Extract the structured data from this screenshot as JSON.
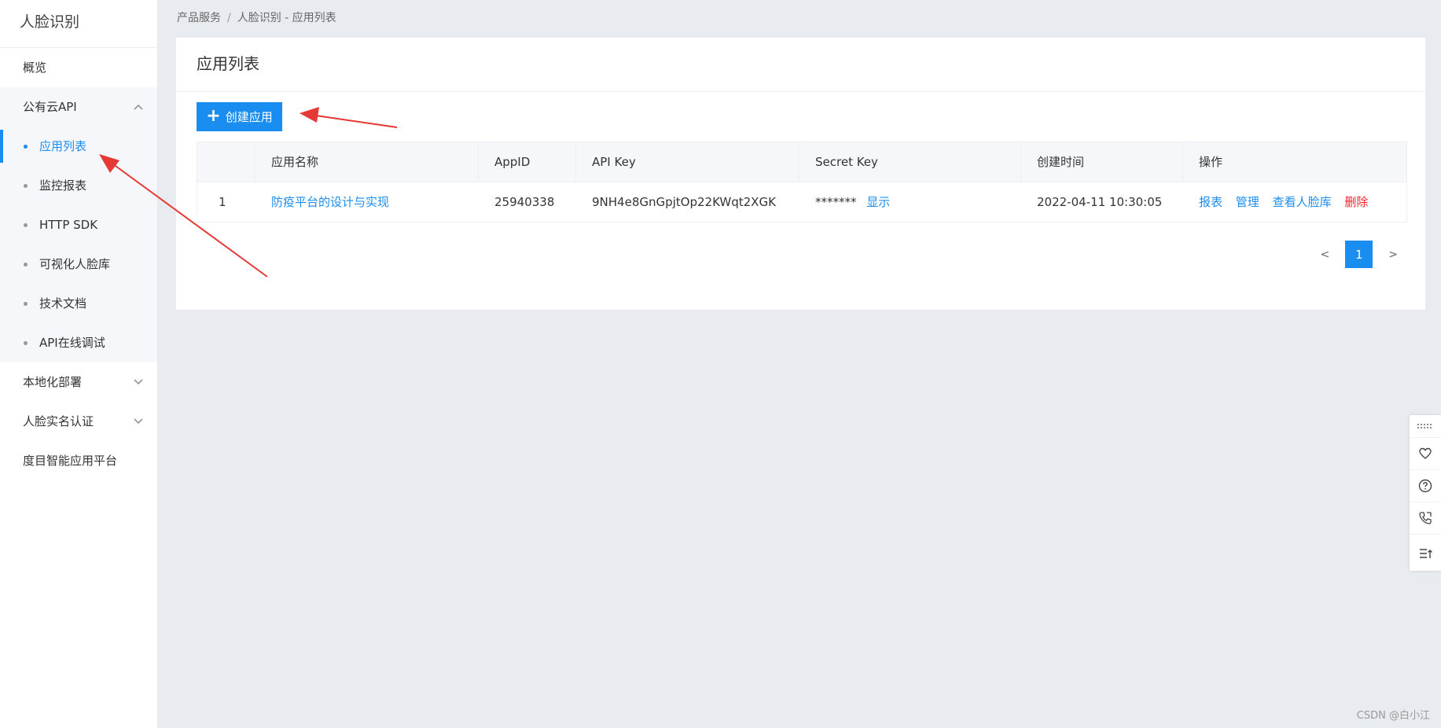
{
  "sidebar": {
    "title": "人脸识别",
    "overview": "概览",
    "group": {
      "label": "公有云API",
      "items": [
        {
          "label": "应用列表",
          "active": true
        },
        {
          "label": "监控报表"
        },
        {
          "label": "HTTP SDK"
        },
        {
          "label": "可视化人脸库"
        },
        {
          "label": "技术文档"
        },
        {
          "label": "API在线调试"
        }
      ]
    },
    "local_deploy": "本地化部署",
    "realname": "人脸实名认证",
    "platform": "度目智能应用平台"
  },
  "breadcrumb": {
    "first": "产品服务",
    "separator": "/",
    "second": "人脸识别 - 应用列表"
  },
  "card": {
    "title": "应用列表",
    "create_button": "创建应用"
  },
  "table": {
    "headers": [
      "",
      "应用名称",
      "AppID",
      "API Key",
      "Secret Key",
      "创建时间",
      "操作"
    ],
    "rows": [
      {
        "index": "1",
        "name": "防疫平台的设计与实现",
        "appid": "25940338",
        "api_key": "9NH4e8GnGpjtOp22KWqt2XGK",
        "secret_masked": "*******",
        "secret_show": "显示",
        "created": "2022-04-11 10:30:05",
        "ops": {
          "report": "报表",
          "manage": "管理",
          "faces": "查看人脸库",
          "delete": "删除"
        }
      }
    ]
  },
  "pagination": {
    "prev": "<",
    "current": "1",
    "next": ">"
  },
  "watermark": "CSDN @白小江",
  "colors": {
    "accent": "#1a8df0",
    "danger": "#f5222d",
    "arrow": "#e53935"
  }
}
